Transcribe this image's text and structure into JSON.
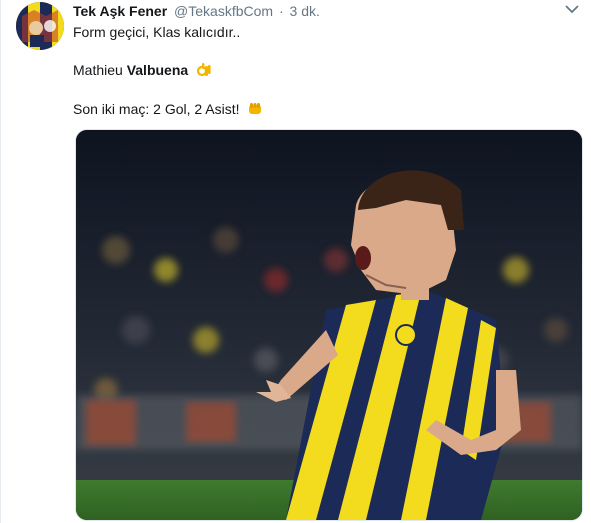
{
  "tweet": {
    "display_name": "Tek Aşk Fener",
    "handle": "@TekaskfbCom",
    "separator": "·",
    "time": "3 dk.",
    "line1": "Form geçici, Klas kalıcıdır..",
    "line2_prefix": "Mathieu ",
    "line2_bold": "Valbuena",
    "line3": "Son iki maç: 2 Gol, 2 Asist!"
  },
  "icons": {
    "menu": "chevron-down-icon",
    "ok_hand": "ok-hand-emoji-icon",
    "fist": "oncoming-fist-emoji-icon"
  },
  "colors": {
    "text": "#14171a",
    "muted": "#657786",
    "kit_navy": "#1c2a57",
    "kit_yellow": "#f3dc1d",
    "pitch": "#3f7a2e"
  }
}
